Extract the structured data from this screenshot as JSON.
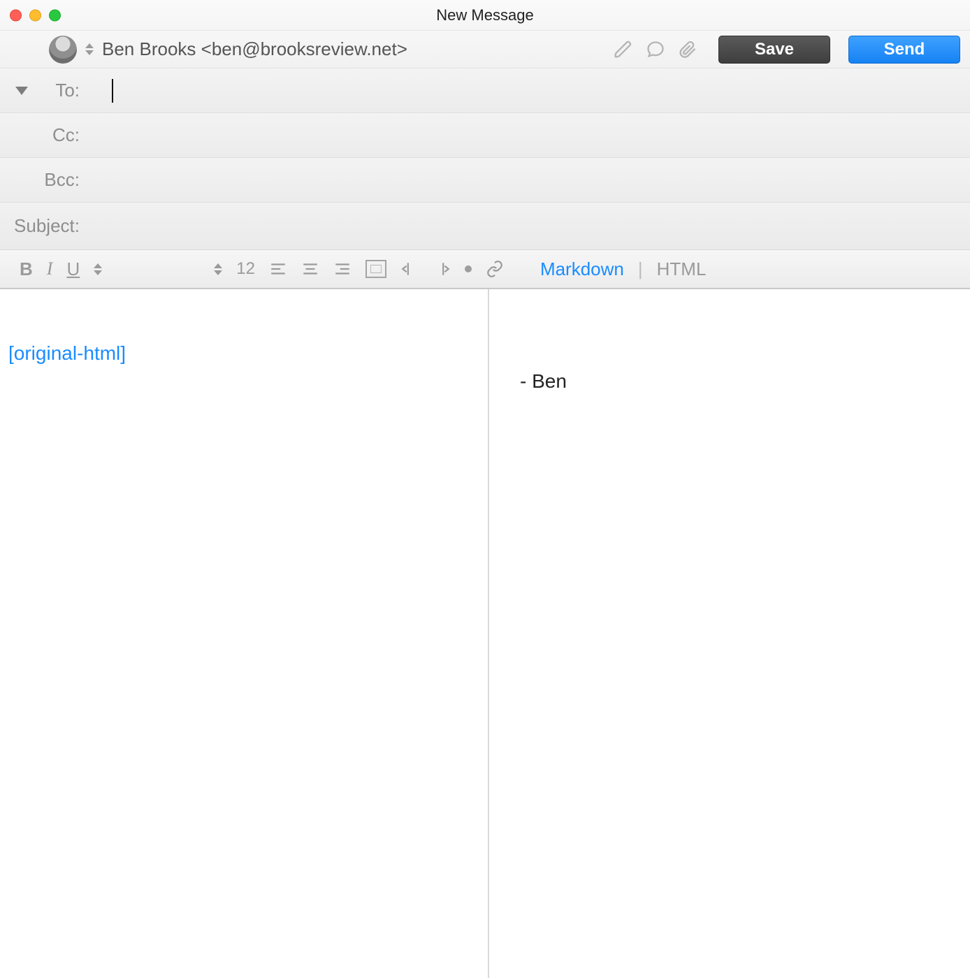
{
  "window": {
    "title": "New Message"
  },
  "from": {
    "name": "Ben Brooks <ben@brooksreview.net>"
  },
  "actions": {
    "save": "Save",
    "send": "Send"
  },
  "fields": {
    "to_label": "To:",
    "cc_label": "Cc:",
    "bcc_label": "Bcc:",
    "subject_label": "Subject:",
    "to_value": "",
    "cc_value": "",
    "bcc_value": "",
    "subject_value": ""
  },
  "toolbar": {
    "bold": "B",
    "italic": "I",
    "underline": "U",
    "fontsize": "12",
    "mode_markdown": "Markdown",
    "mode_html": "HTML",
    "mode_divider": "|"
  },
  "body": {
    "left_tag": "[original-html]",
    "right_signature": "- Ben"
  }
}
